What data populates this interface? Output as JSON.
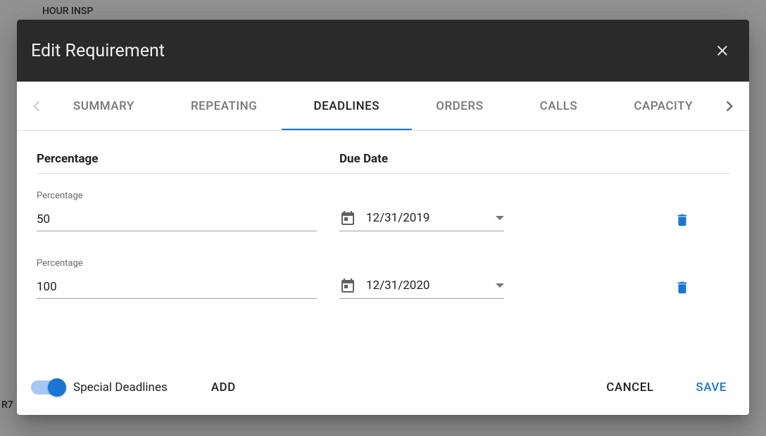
{
  "backdrop": {
    "text1": "HOUR INSP",
    "text2": "R7"
  },
  "dialog": {
    "title": "Edit Requirement"
  },
  "tabs": {
    "items": [
      {
        "label": "SUMMARY"
      },
      {
        "label": "REPEATING"
      },
      {
        "label": "DEADLINES"
      },
      {
        "label": "ORDERS"
      },
      {
        "label": "CALLS"
      },
      {
        "label": "CAPACITY"
      }
    ],
    "active_index": 2
  },
  "columns": {
    "percentage": "Percentage",
    "due_date": "Due Date"
  },
  "rows": [
    {
      "percentage_label": "Percentage",
      "percentage_value": "50",
      "date_value": "12/31/2019"
    },
    {
      "percentage_label": "Percentage",
      "percentage_value": "100",
      "date_value": "12/31/2020"
    }
  ],
  "footer": {
    "toggle_label": "Special Deadlines",
    "add_label": "ADD",
    "cancel_label": "CANCEL",
    "save_label": "SAVE"
  },
  "icons": {
    "close": "close-icon",
    "chevron_left": "chevron-left-icon",
    "chevron_right": "chevron-right-icon",
    "calendar": "calendar-icon",
    "caret_down": "caret-down-icon",
    "trash": "trash-icon"
  }
}
